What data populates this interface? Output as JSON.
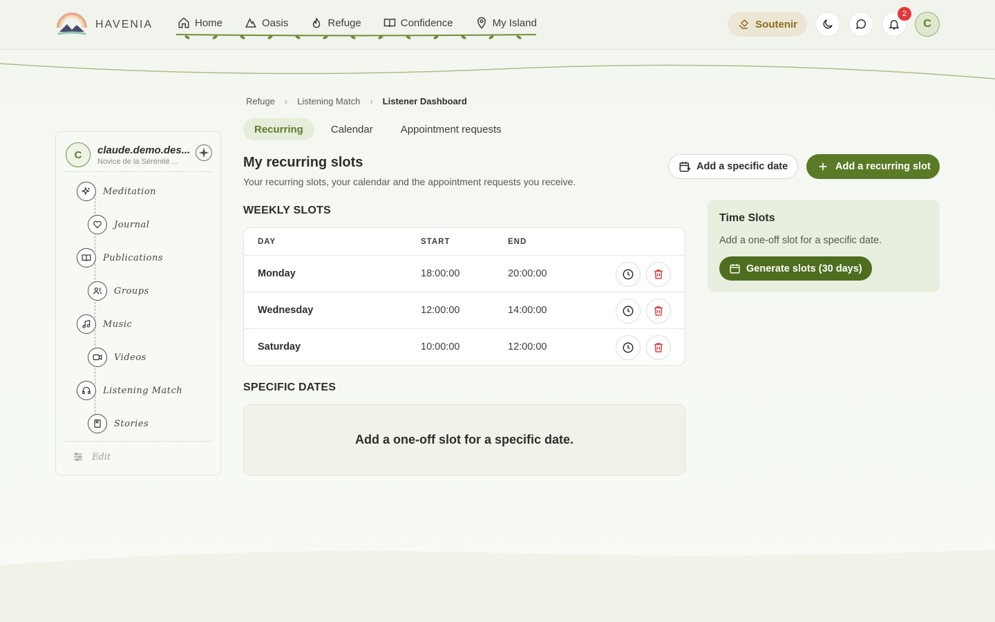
{
  "header": {
    "brand": "HAVENIA",
    "nav": [
      {
        "label": "Home",
        "icon": "home-icon"
      },
      {
        "label": "Oasis",
        "icon": "mountain-icon"
      },
      {
        "label": "Refuge",
        "icon": "flame-icon"
      },
      {
        "label": "Confidence",
        "icon": "book-open-icon"
      },
      {
        "label": "My Island",
        "icon": "map-pin-icon"
      }
    ],
    "support_label": "Soutenir",
    "notification_count": "2",
    "avatar_initial": "C"
  },
  "sidebar": {
    "profile": {
      "initial": "C",
      "name": "claude.demo.des...",
      "rank": "Novice de la Sérénité ..."
    },
    "items": [
      {
        "label": "Meditation",
        "icon": "sparkles-icon"
      },
      {
        "label": "Journal",
        "icon": "heart-icon"
      },
      {
        "label": "Publications",
        "icon": "book-icon"
      },
      {
        "label": "Groups",
        "icon": "users-icon"
      },
      {
        "label": "Music",
        "icon": "music-icon"
      },
      {
        "label": "Videos",
        "icon": "video-icon"
      },
      {
        "label": "Listening Match",
        "icon": "headphones-icon"
      },
      {
        "label": "Stories",
        "icon": "bookmark-book-icon"
      }
    ],
    "edit_label": "Edit"
  },
  "breadcrumb": [
    "Refuge",
    "Listening Match",
    "Listener Dashboard"
  ],
  "tabs": [
    {
      "label": "Recurring",
      "active": true
    },
    {
      "label": "Calendar",
      "active": false
    },
    {
      "label": "Appointment requests",
      "active": false
    }
  ],
  "main": {
    "title": "My recurring slots",
    "subtitle": "Your recurring slots, your calendar and the appointment requests you receive.",
    "add_specific_label": "Add a specific date",
    "add_recurring_label": "Add a recurring slot",
    "weekly_title": "WEEKLY SLOTS",
    "columns": [
      "DAY",
      "START",
      "END"
    ],
    "rows": [
      {
        "day": "Monday",
        "start": "18:00:00",
        "end": "20:00:00"
      },
      {
        "day": "Wednesday",
        "start": "12:00:00",
        "end": "14:00:00"
      },
      {
        "day": "Saturday",
        "start": "10:00:00",
        "end": "12:00:00"
      }
    ],
    "specific_title": "SPECIFIC DATES",
    "specific_empty": "Add a one-off slot for a specific date."
  },
  "time_slots_card": {
    "title": "Time Slots",
    "text": "Add a one-off slot for a specific date.",
    "button_label": "Generate slots (30 days)"
  },
  "colors": {
    "accent": "#5b7a26",
    "danger": "#d64545",
    "badge": "#e03b3b"
  }
}
